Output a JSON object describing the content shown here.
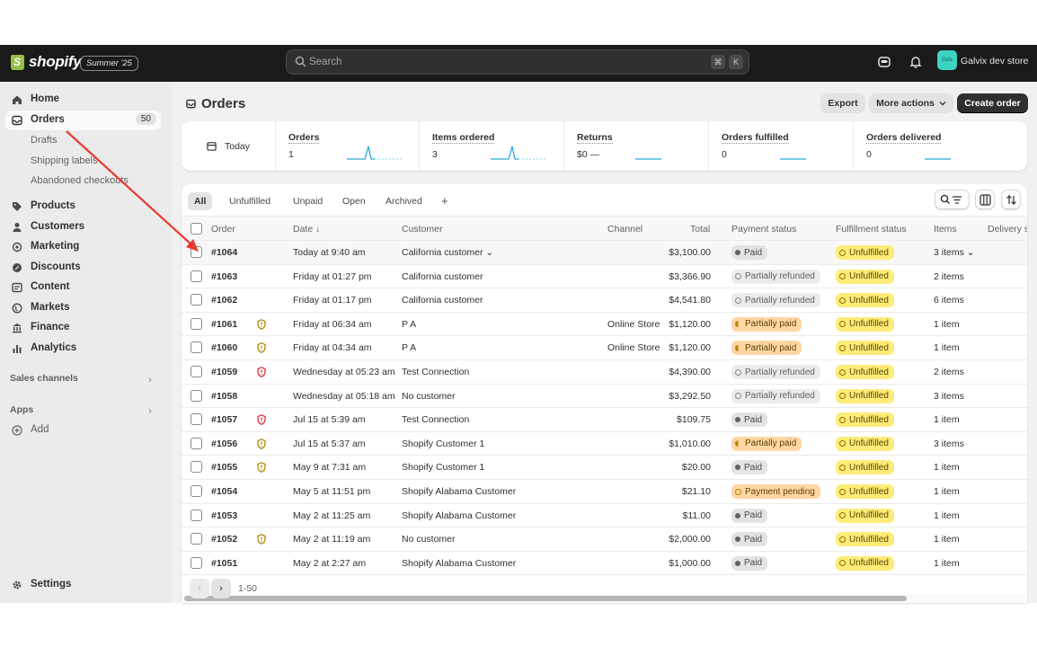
{
  "brand": {
    "name": "shopify",
    "edition": "Summer '25"
  },
  "search": {
    "placeholder": "Search",
    "shortcut_keys": [
      "⌘",
      "K"
    ]
  },
  "topbar": {
    "store_initials": "Gds",
    "store_name": "Galvix dev store"
  },
  "sidebar": {
    "home": "Home",
    "orders": "Orders",
    "orders_count": "50",
    "drafts": "Drafts",
    "shipping_labels": "Shipping labels",
    "abandoned_checkouts": "Abandoned checkouts",
    "products": "Products",
    "customers": "Customers",
    "marketing": "Marketing",
    "discounts": "Discounts",
    "content": "Content",
    "markets": "Markets",
    "finance": "Finance",
    "analytics": "Analytics",
    "sales_channels": "Sales channels",
    "apps": "Apps",
    "add": "Add",
    "settings": "Settings"
  },
  "page": {
    "title": "Orders",
    "export": "Export",
    "more_actions": "More actions",
    "create_order": "Create order"
  },
  "stats": {
    "period": "Today",
    "items": [
      {
        "title": "Orders",
        "value": "1"
      },
      {
        "title": "Items ordered",
        "value": "3"
      },
      {
        "title": "Returns",
        "value": "$0 —"
      },
      {
        "title": "Orders fulfilled",
        "value": "0"
      },
      {
        "title": "Orders delivered",
        "value": "0"
      }
    ]
  },
  "tabs": [
    "All",
    "Unfulfilled",
    "Unpaid",
    "Open",
    "Archived",
    "+"
  ],
  "columns": {
    "order": "Order",
    "date": "Date ↓",
    "customer": "Customer",
    "channel": "Channel",
    "total": "Total",
    "payment_status": "Payment status",
    "fulfillment_status": "Fulfillment status",
    "items": "Items",
    "delivery": "Delivery s"
  },
  "orders": [
    {
      "id": "#1064",
      "date": "Today at 9:40 am",
      "customer": "California customer ⌄",
      "channel": "",
      "total": "$3,100.00",
      "payment": "Paid",
      "ptype": "paid",
      "fulfillment": "Unfulfilled",
      "items": "3 items ⌄",
      "risk": ""
    },
    {
      "id": "#1063",
      "date": "Friday at 01:27 pm",
      "customer": "California customer",
      "channel": "",
      "total": "$3,366.90",
      "payment": "Partially refunded",
      "ptype": "refunded",
      "fulfillment": "Unfulfilled",
      "items": "2 items",
      "risk": ""
    },
    {
      "id": "#1062",
      "date": "Friday at 01:17 pm",
      "customer": "California customer",
      "channel": "",
      "total": "$4,541.80",
      "payment": "Partially refunded",
      "ptype": "refunded",
      "fulfillment": "Unfulfilled",
      "items": "6 items",
      "risk": ""
    },
    {
      "id": "#1061",
      "date": "Friday at 06:34 am",
      "customer": "P A",
      "channel": "Online Store",
      "total": "$1,120.00",
      "payment": "Partially paid",
      "ptype": "ppaid",
      "fulfillment": "Unfulfilled",
      "items": "1 item",
      "risk": "medium"
    },
    {
      "id": "#1060",
      "date": "Friday at 04:34 am",
      "customer": "P A",
      "channel": "Online Store",
      "total": "$1,120.00",
      "payment": "Partially paid",
      "ptype": "ppaid",
      "fulfillment": "Unfulfilled",
      "items": "1 item",
      "risk": "medium"
    },
    {
      "id": "#1059",
      "date": "Wednesday at 05:23 am",
      "customer": "Test Connection",
      "channel": "",
      "total": "$4,390.00",
      "payment": "Partially refunded",
      "ptype": "refunded",
      "fulfillment": "Unfulfilled",
      "items": "2 items",
      "risk": "high"
    },
    {
      "id": "#1058",
      "date": "Wednesday at 05:18 am",
      "customer": "No customer",
      "channel": "",
      "total": "$3,292.50",
      "payment": "Partially refunded",
      "ptype": "refunded",
      "fulfillment": "Unfulfilled",
      "items": "3 items",
      "risk": ""
    },
    {
      "id": "#1057",
      "date": "Jul 15 at 5:39 am",
      "customer": "Test Connection",
      "channel": "",
      "total": "$109.75",
      "payment": "Paid",
      "ptype": "paid",
      "fulfillment": "Unfulfilled",
      "items": "1 item",
      "risk": "high"
    },
    {
      "id": "#1056",
      "date": "Jul 15 at 5:37 am",
      "customer": "Shopify Customer 1",
      "channel": "",
      "total": "$1,010.00",
      "payment": "Partially paid",
      "ptype": "ppaid",
      "fulfillment": "Unfulfilled",
      "items": "3 items",
      "risk": "medium"
    },
    {
      "id": "#1055",
      "date": "May 9 at 7:31 am",
      "customer": "Shopify Customer 1",
      "channel": "",
      "total": "$20.00",
      "payment": "Paid",
      "ptype": "paid",
      "fulfillment": "Unfulfilled",
      "items": "1 item",
      "risk": "medium"
    },
    {
      "id": "#1054",
      "date": "May 5 at 11:51 pm",
      "customer": "Shopify Alabama Customer",
      "channel": "",
      "total": "$21.10",
      "payment": "Payment pending",
      "ptype": "pending",
      "fulfillment": "Unfulfilled",
      "items": "1 item",
      "risk": ""
    },
    {
      "id": "#1053",
      "date": "May 2 at 11:25 am",
      "customer": "Shopify Alabama Customer",
      "channel": "",
      "total": "$11.00",
      "payment": "Paid",
      "ptype": "paid",
      "fulfillment": "Unfulfilled",
      "items": "1 item",
      "risk": ""
    },
    {
      "id": "#1052",
      "date": "May 2 at 11:19 am",
      "customer": "No customer",
      "channel": "",
      "total": "$2,000.00",
      "payment": "Paid",
      "ptype": "paid",
      "fulfillment": "Unfulfilled",
      "items": "1 item",
      "risk": "medium"
    },
    {
      "id": "#1051",
      "date": "May 2 at 2:27 am",
      "customer": "Shopify Alabama Customer",
      "channel": "",
      "total": "$1,000.00",
      "payment": "Paid",
      "ptype": "paid",
      "fulfillment": "Unfulfilled",
      "items": "1 item",
      "risk": ""
    }
  ],
  "pagination": {
    "range": "1-50"
  },
  "colors": {
    "accent_arrow": "#e8392f",
    "unfulfilled": "#ffeb78",
    "partially_paid": "#ffd6a4",
    "risk_medium": "#b28400",
    "risk_high": "#e22c38"
  }
}
